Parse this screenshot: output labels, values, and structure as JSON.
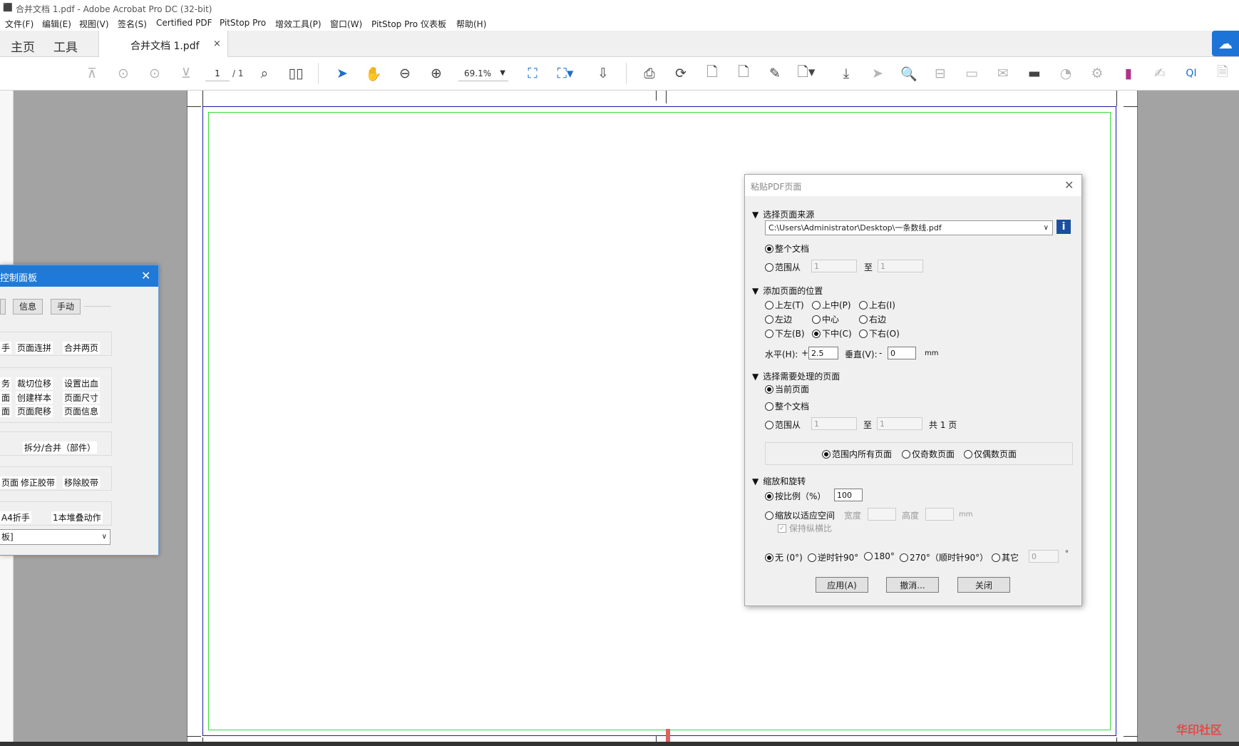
{
  "window": {
    "title": "合并文档 1.pdf - Adobe Acrobat Pro DC (32-bit)"
  },
  "menu": [
    "文件(F)",
    "编辑(E)",
    "视图(V)",
    "签名(S)",
    "Certified PDF",
    "PitStop Pro",
    "增效工具(P)",
    "窗口(W)",
    "PitStop Pro 仪表板",
    "帮助(H)"
  ],
  "tabs": {
    "home": "主页",
    "tools": "工具",
    "document": "合并文档 1.pdf",
    "close": "×"
  },
  "toolbar": {
    "page_current": "1",
    "page_total": "/ 1",
    "zoom": "69.1%"
  },
  "control_panel": {
    "title": "控制面板",
    "top_buttons": [
      "信息",
      "手动"
    ],
    "row1": [
      "手",
      "页面连拼",
      "合并两页"
    ],
    "row2": [
      "务",
      "裁切位移",
      "设置出血"
    ],
    "row3": [
      "面",
      "创建样本",
      "页面尺寸"
    ],
    "row4": [
      "面",
      "页面爬移",
      "页面信息"
    ],
    "row5": "拆分/合并（部件）",
    "row6": [
      "页面",
      "修正胶带",
      "移除胶带"
    ],
    "row7": [
      "A4折手",
      "1本堆叠动作"
    ],
    "select_value": "板]"
  },
  "paste_dialog": {
    "title": "粘贴PDF页面",
    "sec_source": "选择页面来源",
    "source_path": "C:\\Users\\Administrator\\Desktop\\一条数线.pdf",
    "src_whole": "整个文档",
    "src_range": "范围从",
    "src_from": "1",
    "to": "至",
    "src_to": "1",
    "sec_position": "添加页面的位置",
    "positions": [
      "上左(T)",
      "上中(P)",
      "上右(I)",
      "左边",
      "中心",
      "右边",
      "下左(B)",
      "下中(C)",
      "下右(O)"
    ],
    "horiz_label": "水平(H):",
    "plus": "+",
    "horiz_value": "2.5",
    "vert_label": "垂直(V):",
    "minus": "-",
    "vert_value": "0",
    "unit": "mm",
    "sec_pages": "选择需要处理的页面",
    "pg_current": "当前页面",
    "pg_whole": "整个文档",
    "pg_range": "范围从",
    "pg_from": "1",
    "pg_to": "1",
    "pg_total": "共 1 页",
    "filter_all": "范围内所有页面",
    "filter_odd": "仅奇数页面",
    "filter_even": "仅偶数页面",
    "sec_scale": "缩放和旋转",
    "scale_pct": "按比例（%）",
    "scale_value": "100",
    "scale_fit": "缩放以适应空间",
    "width": "宽度",
    "height": "高度",
    "keep_ratio": "保持纵横比",
    "rot_none": "无 (0°)",
    "rot_ccw": "逆时针90°",
    "rot_180": "180°",
    "rot_270": "270°（顺时针90°）",
    "rot_other": "其它",
    "rot_other_value": "0",
    "degree": "°",
    "btn_apply": "应用(A)",
    "btn_cancel": "撤消...",
    "btn_close": "关闭"
  },
  "watermark": "华印社区",
  "colors": {
    "accent": "#1d74d8",
    "page_bg": "#a3a3a3",
    "margin_green": "#33dd33",
    "trim_blue": "#1a1aaa"
  }
}
